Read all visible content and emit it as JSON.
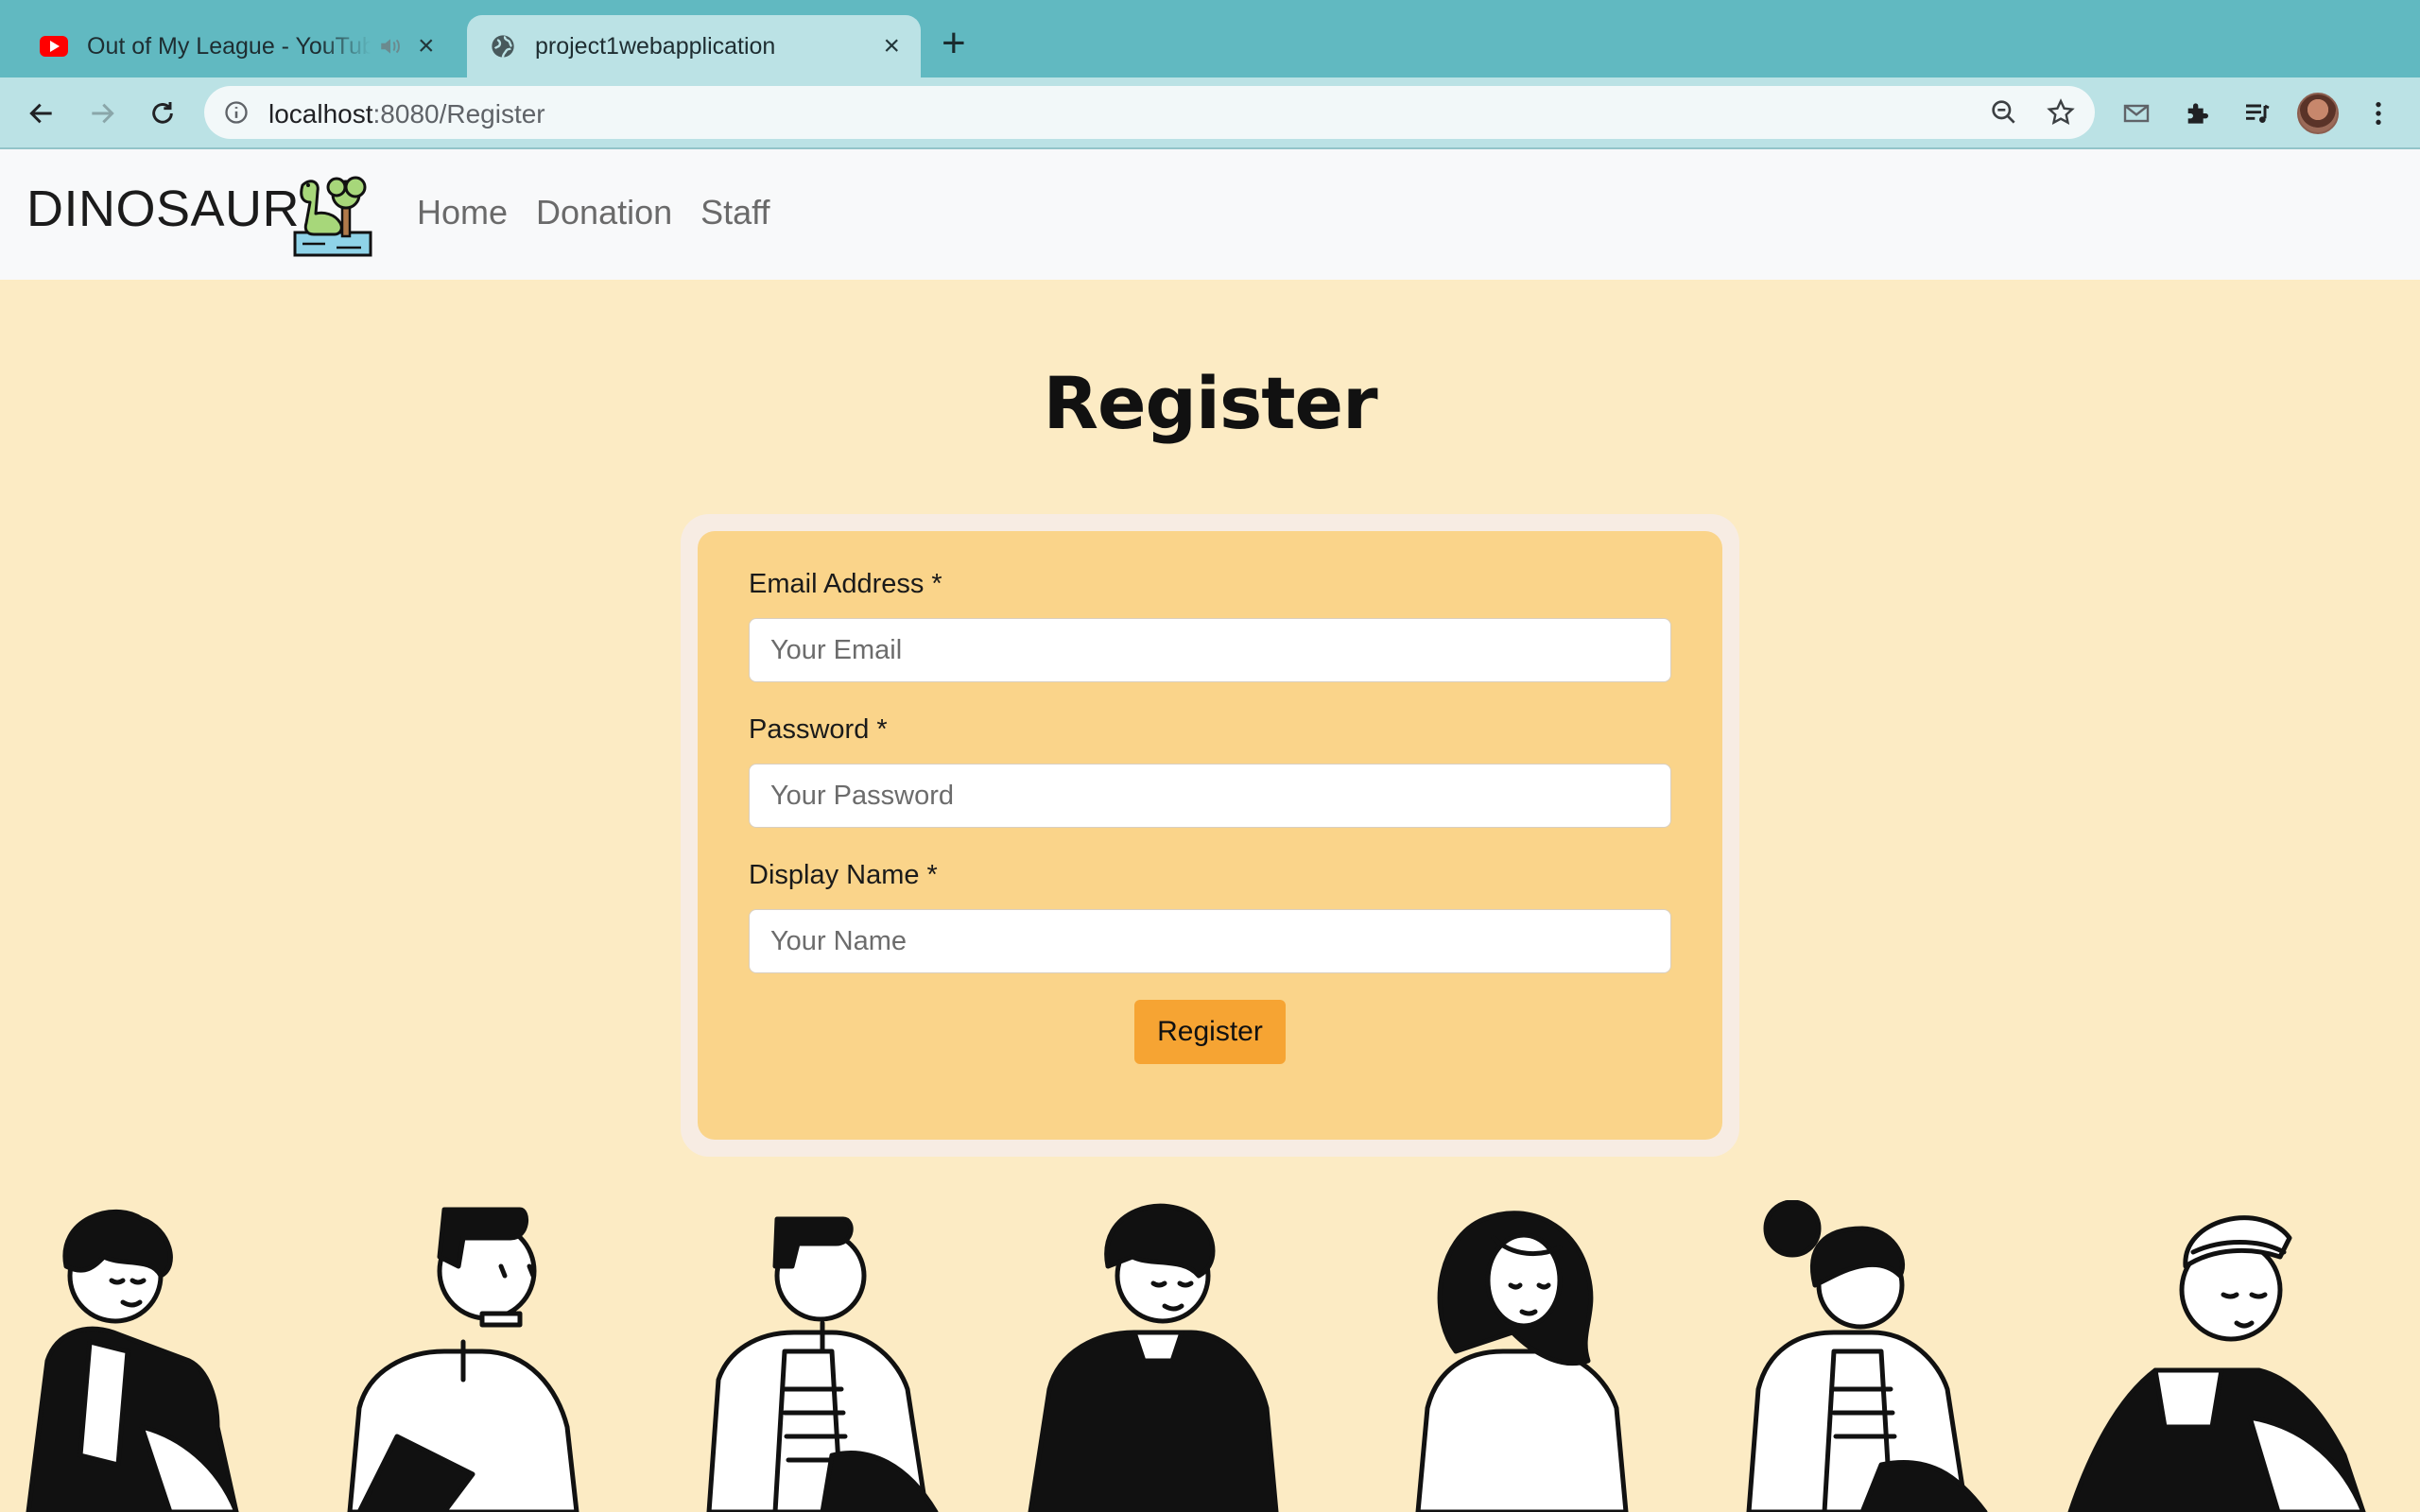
{
  "browser": {
    "tabs": [
      {
        "title": "Out of My League - YouTube",
        "favicon": "youtube-icon",
        "audio": "speaker-icon"
      },
      {
        "title": "project1webapplication",
        "favicon": "globe-icon",
        "active": true
      }
    ],
    "url_host": "localhost",
    "url_path": ":8080/Register",
    "colors": {
      "tabbar": "#61b9c1",
      "toolbar": "#bbe2e5"
    }
  },
  "site": {
    "brand": "DINOSAUR",
    "nav": [
      "Home",
      "Donation",
      "Staff"
    ]
  },
  "page": {
    "title": "Register",
    "form": {
      "email_label": "Email Address *",
      "email_placeholder": "Your Email",
      "password_label": "Password *",
      "password_placeholder": "Your Password",
      "name_label": "Display Name *",
      "name_placeholder": "Your Name",
      "submit_label": "Register"
    },
    "colors": {
      "background": "#fcebc4",
      "card": "#fad48a",
      "button": "#f6a433"
    }
  }
}
